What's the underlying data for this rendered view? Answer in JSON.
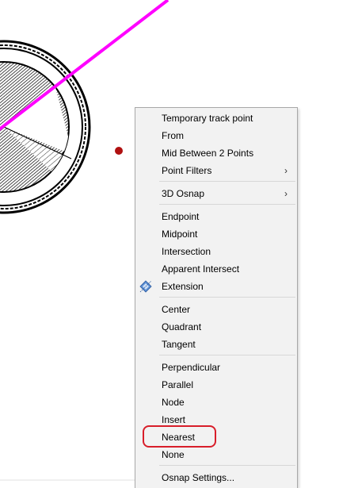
{
  "menu": {
    "items": [
      {
        "label": "Temporary track point"
      },
      {
        "label": "From"
      },
      {
        "label": "Mid Between 2 Points"
      },
      {
        "label": "Point Filters",
        "submenu": true
      },
      {
        "label": "3D Osnap",
        "submenu": true
      },
      {
        "label": "Endpoint"
      },
      {
        "label": "Midpoint"
      },
      {
        "label": "Intersection"
      },
      {
        "label": "Apparent Intersect"
      },
      {
        "label": "Extension",
        "icon": "extension-icon"
      },
      {
        "label": "Center"
      },
      {
        "label": "Quadrant"
      },
      {
        "label": "Tangent"
      },
      {
        "label": "Perpendicular"
      },
      {
        "label": "Parallel"
      },
      {
        "label": "Node"
      },
      {
        "label": "Insert"
      },
      {
        "label": "Nearest",
        "highlighted": true
      },
      {
        "label": "None"
      },
      {
        "label": "Osnap Settings..."
      }
    ],
    "submenu_arrow": "›"
  },
  "colors": {
    "construction_line": "#ff00ff",
    "highlight_outline": "#d81e2a",
    "point_marker": "#b01010",
    "menu_background": "#f2f2f2"
  },
  "icons": [
    "extension-icon",
    "chevron-right-icon"
  ]
}
